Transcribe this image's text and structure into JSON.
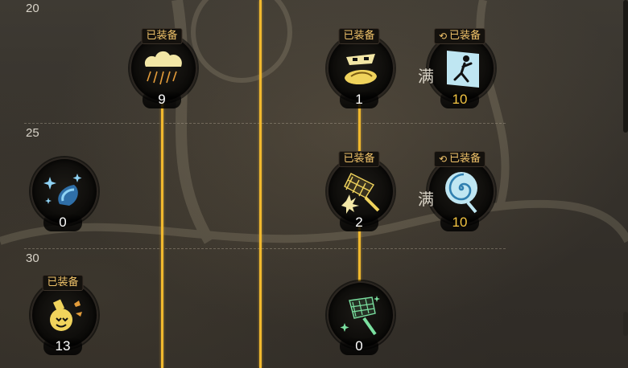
{
  "levels": [
    "20",
    "25",
    "30"
  ],
  "equipped_label": "已装备",
  "max_label": "满",
  "skills": {
    "rain_cloud": {
      "icon": "rain-cloud-icon",
      "count": "9",
      "equipped": true
    },
    "masked_snake": {
      "icon": "masked-snake-icon",
      "count": "1",
      "equipped": true
    },
    "exit_runner": {
      "icon": "exit-runner-icon",
      "count": "10",
      "equipped": true,
      "maxed": true
    },
    "ice_claw": {
      "icon": "ice-claw-icon",
      "count": "0",
      "equipped": false
    },
    "swatter_burst": {
      "icon": "swatter-burst-icon",
      "count": "2",
      "equipped": true
    },
    "spiral_candy": {
      "icon": "spiral-candy-icon",
      "count": "10",
      "equipped": true,
      "maxed": true
    },
    "bomb_potion": {
      "icon": "bomb-potion-icon",
      "count": "13",
      "equipped": true
    },
    "sparkle_swatter": {
      "icon": "sparkle-swatter-icon",
      "count": "0",
      "equipped": false
    }
  },
  "colors": {
    "accent": "#f0b82e",
    "badge_text": "#f0c36a",
    "max_count": "#f4c542"
  }
}
